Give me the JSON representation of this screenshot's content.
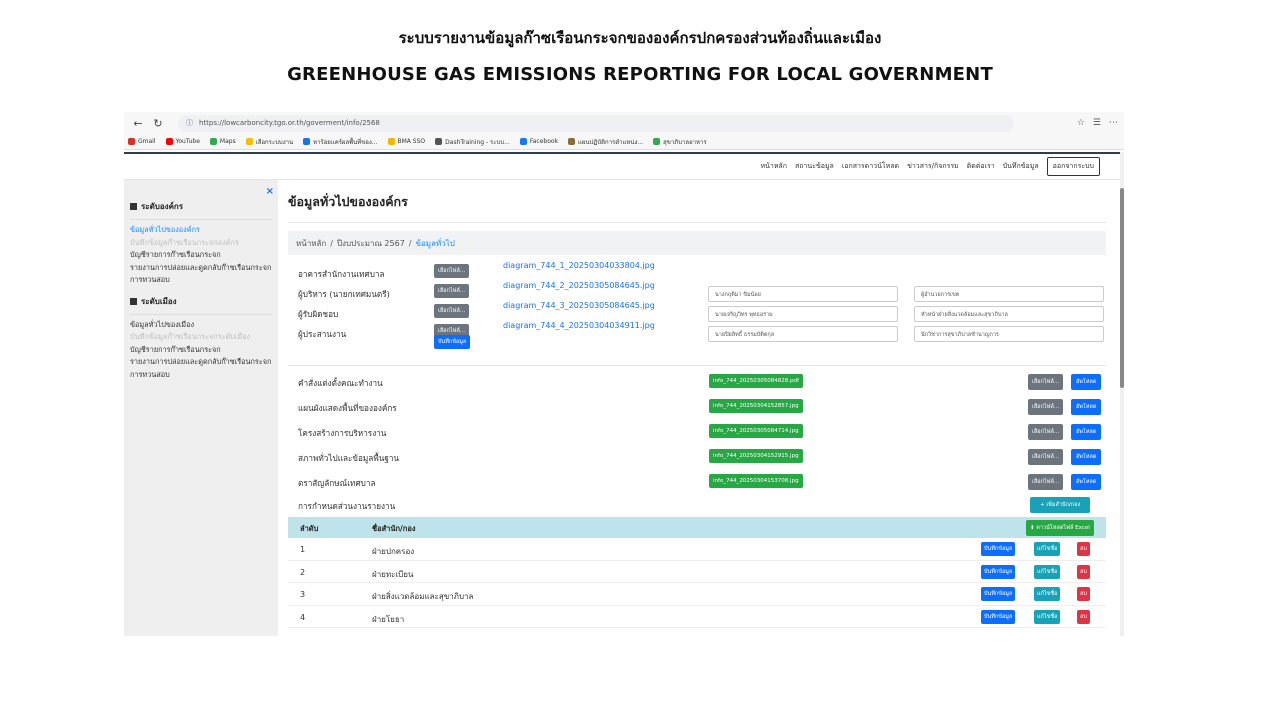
{
  "slide": {
    "title_th": "ระบบรายงานข้อมูลก๊าซเรือนกระจกขององค์กรปกครองส่วนท้องถิ่นและเมือง",
    "title_en": "GREENHOUSE GAS EMISSIONS REPORTING FOR LOCAL GOVERNMENT"
  },
  "browser": {
    "url": "https://lowcarboncity.tgo.or.th/goverment/info/2568",
    "bookmarks": [
      {
        "label": "Gmail",
        "color": "#d93025"
      },
      {
        "label": "YouTube",
        "color": "#ff0000"
      },
      {
        "label": "Maps",
        "color": "#34a853"
      },
      {
        "label": "เลือกระบบงาน",
        "color": "#fbbc04"
      },
      {
        "label": "หาร้อยแคร์ผลพื้นที่ของ...",
        "color": "#1a73e8"
      },
      {
        "label": "BMA SSO",
        "color": "#f2b705"
      },
      {
        "label": "DashTraining - ระบบ...",
        "color": "#555555"
      },
      {
        "label": "Facebook",
        "color": "#1877f2"
      },
      {
        "label": "แผนปฏิบัติการตำแหน่ง...",
        "color": "#8a6d3b"
      },
      {
        "label": "สุขาภิบาลอาหาร",
        "color": "#34a853"
      }
    ]
  },
  "site_nav": {
    "items": [
      "หน้าหลัก",
      "สถานะข้อมูล",
      "เอกสารดาวน์โหลด",
      "ข่าวสาร/กิจกรรม",
      "ติดต่อเรา",
      "บันทึกข้อมูล"
    ],
    "logout": "ออกจากระบบ"
  },
  "sidebar": {
    "close": "×",
    "section1": {
      "title": "ระดับองค์กร",
      "items": [
        {
          "label": "ข้อมูลทั่วไปขององค์กร",
          "state": "active"
        },
        {
          "label": "บันทึกข้อมูลก๊าซเรือนกระจกองค์กร",
          "state": "muted"
        },
        {
          "label": "บัญชีรายการก๊าซเรือนกระจก",
          "state": "normal"
        },
        {
          "label": "รายงานการปล่อยและดูดกลับก๊าซเรือนกระจก",
          "state": "normal"
        },
        {
          "label": "การทวนสอบ",
          "state": "normal"
        }
      ]
    },
    "section2": {
      "title": "ระดับเมือง",
      "items": [
        {
          "label": "ข้อมูลทั่วไปของเมือง",
          "state": "normal"
        },
        {
          "label": "บันทึกข้อมูลก๊าซเรือนกระจกระดับเมือง",
          "state": "muted"
        },
        {
          "label": "บัญชีรายการก๊าซเรือนกระจก",
          "state": "normal"
        },
        {
          "label": "รายงานการปล่อยและดูดกลับก๊าซเรือนกระจก",
          "state": "normal"
        },
        {
          "label": "การทวนสอบ",
          "state": "normal"
        }
      ]
    }
  },
  "main": {
    "title": "ข้อมูลทั่วไปขององค์กร",
    "breadcrumb": [
      "หน้าหลัก",
      "ปีงบประมาณ 2567",
      "ข้อมูลทั่วไป"
    ],
    "choose_file": "เลือกไฟล์...",
    "save_label": "บันทึกข้อมูล",
    "info_rows": [
      {
        "label": "อาคารสำนักงานเทศบาล",
        "file": "diagram_744_1_20250304033804.jpg",
        "name": "",
        "position": ""
      },
      {
        "label": "ผู้บริหาร (นายกเทศมนตรี)",
        "file": "diagram_744_2_20250305084645.jpg",
        "name": "นางกฤติมา ขิมน้อย",
        "position": "ผู้อำนวยการเขต"
      },
      {
        "label": "ผู้รับผิดชอบ",
        "file": "diagram_744_3_20250305084645.jpg",
        "name": "นายเจริญวิทร พุทธอร่าม",
        "position": "หัวหน้าฝ่ายสิ่งแวดล้อมและสุขาภิบาล"
      },
      {
        "label": "ผู้ประสานงาน",
        "file": "diagram_744_4_20250304034911.jpg",
        "name": "นายปิยลิทธิ์ ธรรมบัติตกุล",
        "position": "นักวิชาการสุขาภิบาลชำนาญการ"
      }
    ],
    "upload_label": "อัพโหลด",
    "docs": [
      {
        "label": "คำสั่งแต่งตั้งคณะทำงาน",
        "file": "info_744_20250305084828.pdf"
      },
      {
        "label": "แผนผังแสดงพื้นที่ขององค์กร",
        "file": "info_744_20250304152857.jpg"
      },
      {
        "label": "โครงสร้างการบริหารงาน",
        "file": "info_744_20250305084714.jpg"
      },
      {
        "label": "สภาพทั่วไปและข้อมูลพื้นฐาน",
        "file": "info_744_20250304152915.jpg"
      },
      {
        "label": "ตราสัญลักษณ์เทศบาล",
        "file": "info_744_20250304153708.jpg"
      }
    ],
    "assign_label": "การกำหนดส่วนงานรายงาน",
    "add_dept": "+ เพิ่มสำนัก/กอง",
    "table": {
      "col1": "ลำดับ",
      "col2": "ชื่อสำนัก/กอง",
      "download_excel": "ดาวน์โหลดไฟล์ Excel",
      "btn_save": "บันทึกข้อมูล",
      "btn_edit": "แก้ไขชื่อ",
      "btn_delete": "ลบ",
      "rows": [
        {
          "no": "1",
          "name": "ฝ่ายปกครอง"
        },
        {
          "no": "2",
          "name": "ฝ่ายทะเบียน"
        },
        {
          "no": "3",
          "name": "ฝ่ายสิ่งแวดล้อมและสุขาภิบาล"
        },
        {
          "no": "4",
          "name": "ฝ่ายโยธา"
        }
      ]
    }
  }
}
